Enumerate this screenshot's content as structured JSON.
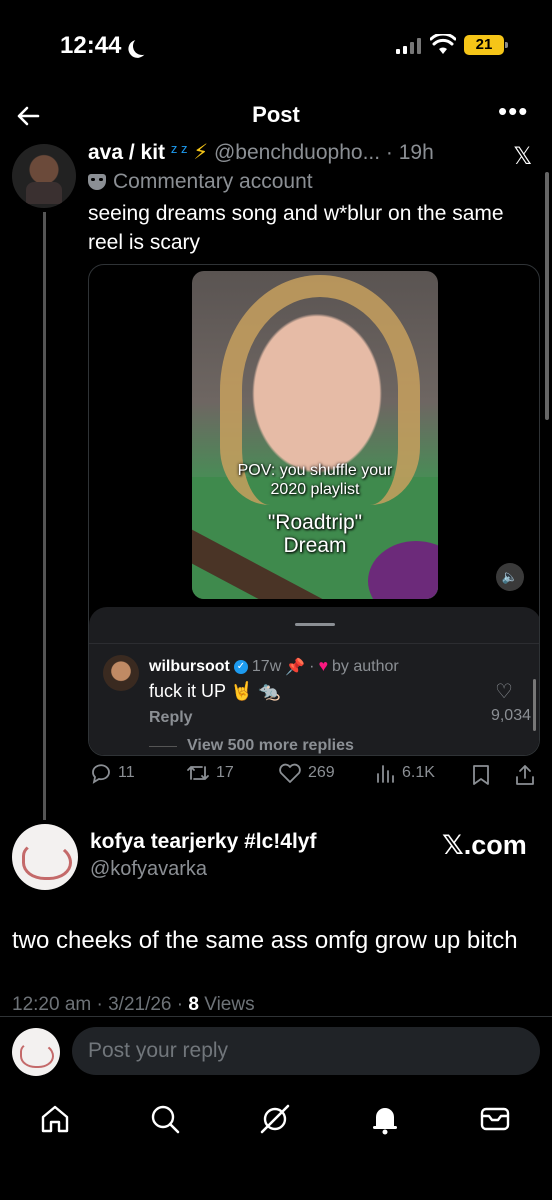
{
  "status": {
    "time": "12:44",
    "battery": "21"
  },
  "header": {
    "title": "Post"
  },
  "quoted_post": {
    "display_name": "ava / kit",
    "zz": "z z",
    "handle_time": "@benchduopho... · 19h",
    "label": "Commentary account",
    "text": "seeing dreams song and w*blur on the same reel is scary",
    "video": {
      "overlay_line1": "POV: you shuffle your",
      "overlay_line2": "2020 playlist",
      "overlay_line3": "\"Roadtrip\"",
      "overlay_line4": "Dream"
    },
    "comment": {
      "user": "wilbursoot",
      "meta": "17w",
      "liked_by": "by author",
      "text": "fuck it UP 🤘 🐀",
      "reply_label": "Reply",
      "likes": "9,034",
      "view_more": "View 500 more replies"
    },
    "actions": {
      "replies": "11",
      "reposts": "17",
      "likes": "269",
      "views": "6.1K"
    }
  },
  "main_post": {
    "display_name": "kofya tearjerky #lc!4lyf",
    "handle": "@kofyavarka",
    "watermark": "𝕏.com",
    "text": "two cheeks of the same ass omfg grow up bitch",
    "timestamp": "12:20 am · 3/21/26 · ",
    "views_count": "8",
    "views_label": " Views"
  },
  "reply_bar": {
    "placeholder": "Post your reply"
  },
  "icons": [
    "back-arrow-icon",
    "more-icon",
    "x-logo-icon",
    "mask-icon",
    "volume-icon",
    "verified-icon",
    "pin-icon",
    "heart-icon",
    "reply-icon",
    "repost-icon",
    "views-icon",
    "bookmark-icon",
    "share-icon",
    "home-icon",
    "search-icon",
    "grok-icon",
    "bell-icon",
    "mail-icon"
  ],
  "colors": {
    "background": "#000000",
    "accent": "#1d9bf0",
    "muted": "#8b8f94",
    "like": "#f91880",
    "battery": "#f5c518"
  }
}
